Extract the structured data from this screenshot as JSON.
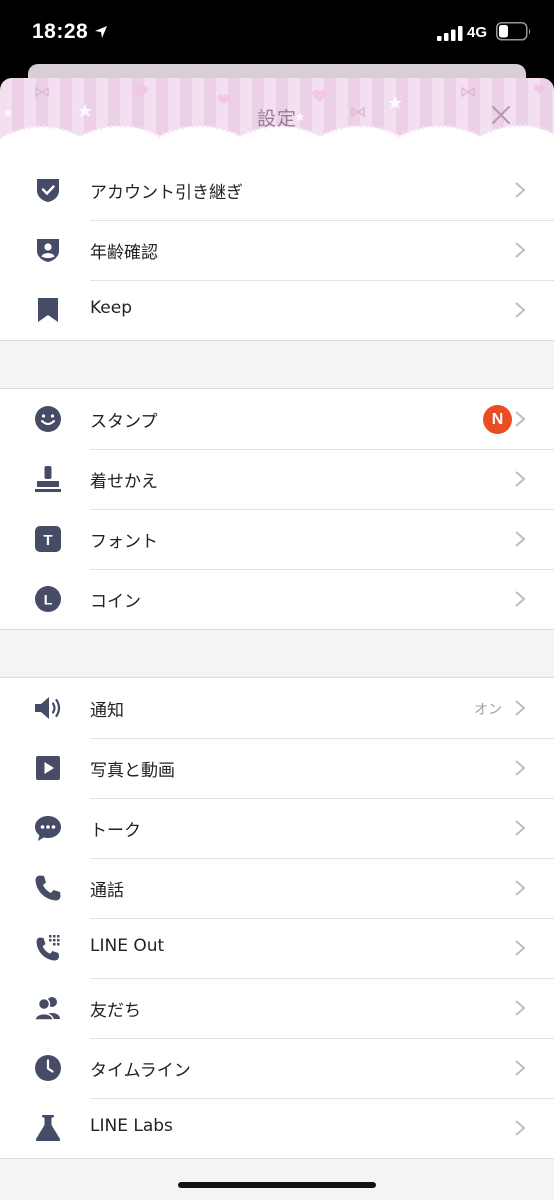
{
  "status": {
    "time": "18:28",
    "network": "4G"
  },
  "header": {
    "title": "設定"
  },
  "groups": [
    {
      "items": [
        {
          "label": "アカウント引き継ぎ",
          "icon": "shield-check-icon"
        },
        {
          "label": "年齢確認",
          "icon": "shield-user-icon"
        },
        {
          "label": "Keep",
          "icon": "bookmark-icon"
        }
      ]
    },
    {
      "items": [
        {
          "label": "スタンプ",
          "icon": "smiley-icon",
          "badge": "N"
        },
        {
          "label": "着せかえ",
          "icon": "paint-brush-icon"
        },
        {
          "label": "フォント",
          "icon": "font-icon",
          "icon_text": "T"
        },
        {
          "label": "コイン",
          "icon": "coin-icon",
          "icon_text": "L"
        }
      ]
    },
    {
      "items": [
        {
          "label": "通知",
          "icon": "speaker-icon",
          "value": "オン"
        },
        {
          "label": "写真と動画",
          "icon": "play-icon"
        },
        {
          "label": "トーク",
          "icon": "chat-bubble-icon"
        },
        {
          "label": "通話",
          "icon": "phone-icon"
        },
        {
          "label": "LINE Out",
          "icon": "phone-dial-icon"
        },
        {
          "label": "友だち",
          "icon": "friends-icon"
        },
        {
          "label": "タイムライン",
          "icon": "clock-icon"
        },
        {
          "label": "LINE Labs",
          "icon": "flask-icon"
        }
      ]
    }
  ],
  "colors": {
    "icon": "#474c66",
    "badge": "#ea4d22",
    "header_stripe_a": "#f4dff0",
    "header_stripe_b": "#ecd0e8",
    "title": "#9b7c93"
  }
}
